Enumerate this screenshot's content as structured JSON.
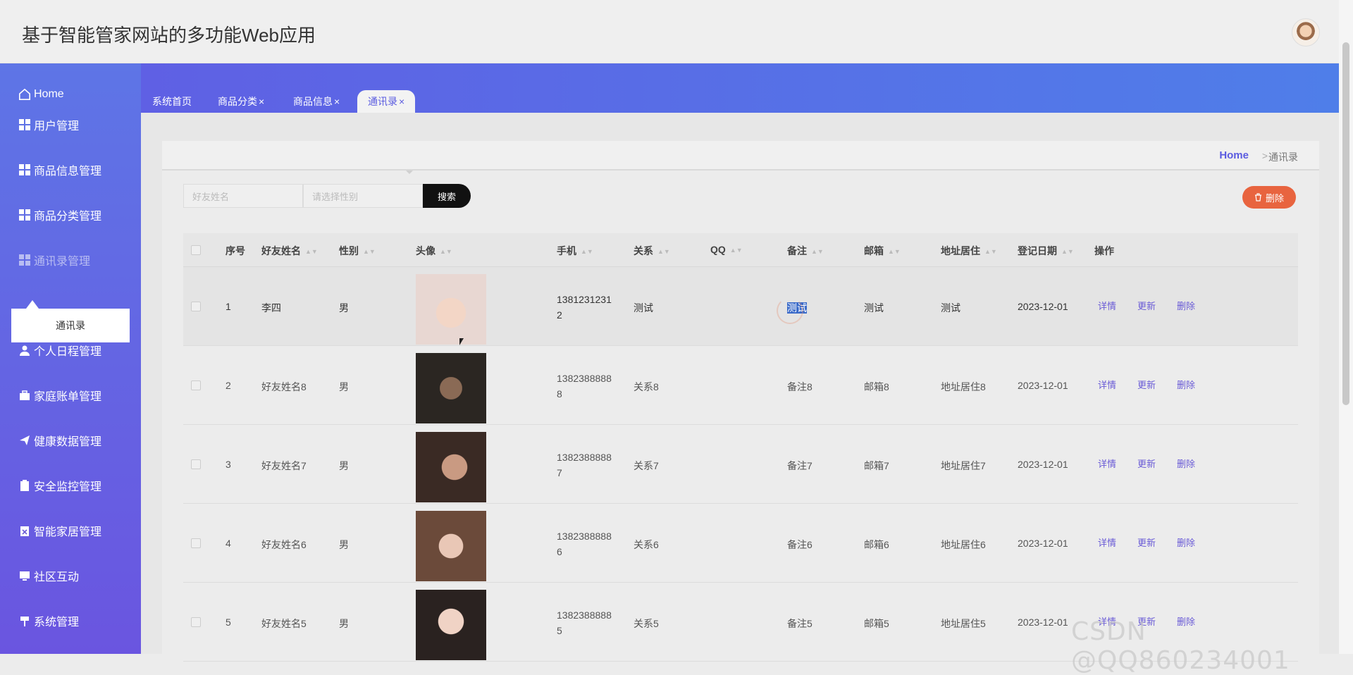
{
  "app": {
    "title": "基于智能管家网站的多功能Web应用"
  },
  "sidebar": {
    "home": "Home",
    "items": [
      {
        "label": "用户管理",
        "icon": "grid-icon"
      },
      {
        "label": "商品信息管理",
        "icon": "grid-icon"
      },
      {
        "label": "商品分类管理",
        "icon": "grid-icon"
      },
      {
        "label": "通讯录管理",
        "icon": "grid-icon"
      },
      {
        "label": "个人日程管理",
        "icon": "user-icon"
      },
      {
        "label": "家庭账单管理",
        "icon": "briefcase-icon"
      },
      {
        "label": "健康数据管理",
        "icon": "send-icon"
      },
      {
        "label": "安全监控管理",
        "icon": "clipboard-icon"
      },
      {
        "label": "智能家居管理",
        "icon": "clipboard-x-icon"
      },
      {
        "label": "社区互动",
        "icon": "monitor-icon"
      },
      {
        "label": "系统管理",
        "icon": "signpost-icon"
      }
    ],
    "submenu": {
      "label": "通讯录"
    }
  },
  "tabs": [
    {
      "label": "系统首页",
      "closable": false
    },
    {
      "label": "商品分类",
      "closable": true
    },
    {
      "label": "商品信息",
      "closable": true
    },
    {
      "label": "通讯录",
      "closable": true,
      "active": true
    }
  ],
  "tab_close_glyph": "×",
  "breadcrumb": {
    "home": "Home",
    "separator": ">",
    "current": "通讯录"
  },
  "search": {
    "name_placeholder": "好友姓名",
    "gender_placeholder": "请选择性别",
    "button": "搜索"
  },
  "delete_button": "删除",
  "table": {
    "headers": [
      "序号",
      "好友姓名",
      "性别",
      "头像",
      "手机",
      "关系",
      "QQ",
      "备注",
      "邮箱",
      "地址居住",
      "登记日期",
      "操作"
    ],
    "sort_glyph": "▲▼",
    "actions": {
      "detail": "详情",
      "update": "更新",
      "delete": "删除"
    },
    "rows": [
      {
        "idx": "1",
        "name": "李四",
        "gender": "男",
        "phone1": "1381231231",
        "phone2": "2",
        "relation": "测试",
        "qq": "",
        "note": "测试",
        "email": "测试",
        "address": "测试",
        "date": "2023-12-01"
      },
      {
        "idx": "2",
        "name": "好友姓名8",
        "gender": "男",
        "phone1": "1382388888",
        "phone2": "8",
        "relation": "关系8",
        "qq": "",
        "note": "备注8",
        "email": "邮箱8",
        "address": "地址居住8",
        "date": "2023-12-01"
      },
      {
        "idx": "3",
        "name": "好友姓名7",
        "gender": "男",
        "phone1": "1382388888",
        "phone2": "7",
        "relation": "关系7",
        "qq": "",
        "note": "备注7",
        "email": "邮箱7",
        "address": "地址居住7",
        "date": "2023-12-01"
      },
      {
        "idx": "4",
        "name": "好友姓名6",
        "gender": "男",
        "phone1": "1382388888",
        "phone2": "6",
        "relation": "关系6",
        "qq": "",
        "note": "备注6",
        "email": "邮箱6",
        "address": "地址居住6",
        "date": "2023-12-01"
      },
      {
        "idx": "5",
        "name": "好友姓名5",
        "gender": "男",
        "phone1": "1382388888",
        "phone2": "5",
        "relation": "关系5",
        "qq": "",
        "note": "备注5",
        "email": "邮箱5",
        "address": "地址居住5",
        "date": "2023-12-01"
      }
    ]
  },
  "watermark": "CSDN @QQ860234001"
}
